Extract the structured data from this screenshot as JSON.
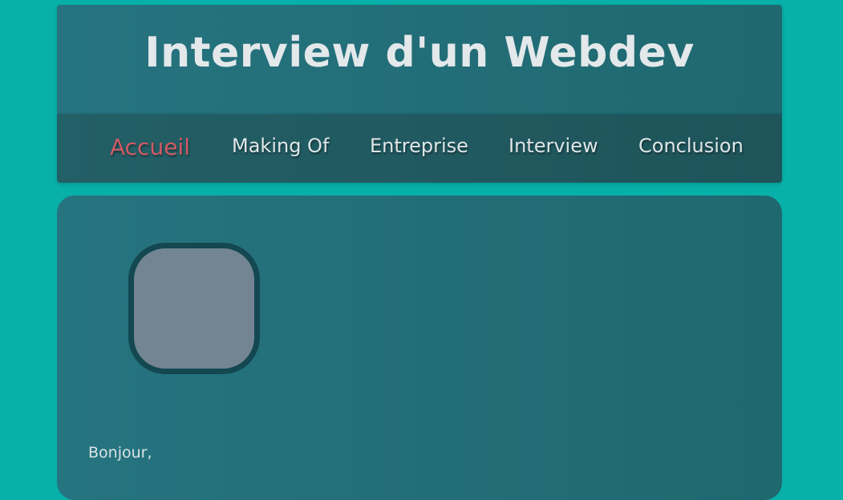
{
  "header": {
    "title": "Interview d'un Webdev"
  },
  "nav": {
    "items": [
      {
        "label": "Accueil",
        "active": true
      },
      {
        "label": "Making Of",
        "active": false
      },
      {
        "label": "Entreprise",
        "active": false
      },
      {
        "label": "Interview",
        "active": false
      },
      {
        "label": "Conclusion",
        "active": false
      }
    ],
    "active_color": "#d05a64"
  },
  "main": {
    "avatar_icon": "profile-image",
    "greeting": "Bonjour,"
  },
  "colors": {
    "page_background": "#07b0a8",
    "panel_background": "#267480",
    "nav_background": "#235f66",
    "text": "#dfe6e8",
    "avatar_border": "#134851",
    "avatar_fill": "#738493"
  }
}
